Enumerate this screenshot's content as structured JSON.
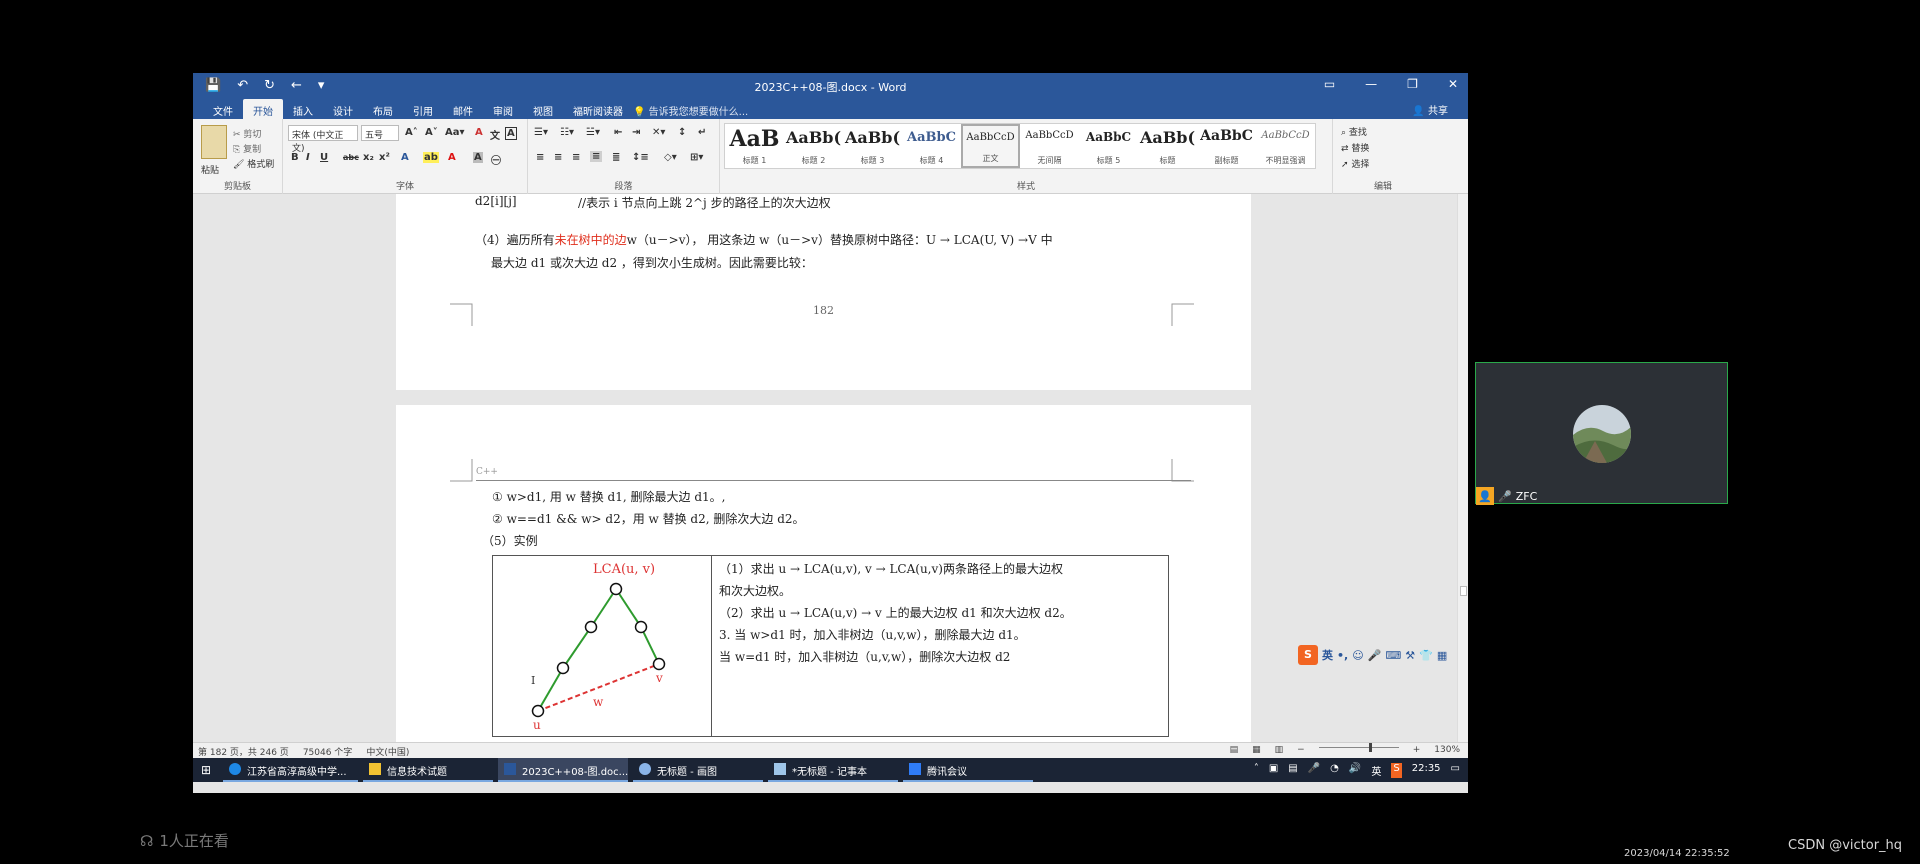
{
  "word": {
    "title": "2023C++08-图.docx - Word",
    "menu_tabs": [
      "文件",
      "开始",
      "插入",
      "设计",
      "布局",
      "引用",
      "邮件",
      "审阅",
      "视图",
      "福昕阅读器"
    ],
    "active_tab_index": 1,
    "tell_me": "告诉我您想要做什么...",
    "share": "共享",
    "ribbon": {
      "clipboard": {
        "paste": "粘贴",
        "cut": "剪切",
        "copy": "复制",
        "format_painter": "格式刷",
        "label": "剪贴板"
      },
      "font": {
        "font_name": "宋体 (中文正文)",
        "font_size": "五号",
        "label": "字体"
      },
      "paragraph": {
        "label": "段落"
      },
      "styles": {
        "label": "样式",
        "items": [
          {
            "sample": "AaB",
            "name": "标题 1"
          },
          {
            "sample": "AaBb(",
            "name": "标题 2"
          },
          {
            "sample": "AaBb(",
            "name": "标题 3"
          },
          {
            "sample": "AaBbC",
            "name": "标题 4"
          },
          {
            "sample": "AaBbCcD",
            "name": "正文"
          },
          {
            "sample": "AaBbCcD",
            "name": "无间隔"
          },
          {
            "sample": "AaBbC",
            "name": "标题 5"
          },
          {
            "sample": "AaBb(",
            "name": "标题"
          },
          {
            "sample": "AaBbC",
            "name": "副标题"
          },
          {
            "sample": "AaBbCcD",
            "name": "不明显强调"
          }
        ]
      },
      "editing": {
        "find": "查找",
        "replace": "替换",
        "select": "选择",
        "label": "编辑"
      }
    },
    "document": {
      "p1_line0_code": "d2[i][j]",
      "p1_line0_comment": "//表示 i 节点向上跳 2^j 步的路径上的次大边权",
      "p1_line1_a": "（4）遍历所有",
      "p1_line1_red": "未在树中的边",
      "p1_line1_b": "w（u－>v），  用这条边 w（u－>v）替换原树中路径：U → LCA(U, V) →V 中",
      "p1_line2": "最大边 d1 或次大边 d2 ，得到次小生成树。因此需要比较：",
      "page_number": "182",
      "header_text": "C++",
      "p2_line1": "① w>d1,   用 w 替换 d1,   删除最大边 d1。,",
      "p2_line2": "② w==d1 && w> d2，用 w 替换 d2,   删除次大边 d2。",
      "p2_line3": "（5）实例",
      "diagram": {
        "title": "LCA(u, v)",
        "label_u": "u",
        "label_v": "v",
        "label_w": "w",
        "label_l": "I"
      },
      "box_lines": [
        "（1）求出 u → LCA(u,v),  v → LCA(u,v)两条路径上的最大边权",
        "和次大边权。",
        "（2）求出 u → LCA(u,v) → v 上的最大边权 d1 和次大边权 d2。",
        "3.  当 w>d1 时，加入非树边（u,v,w），删除最大边 d1。",
        "    当 w=d1 时，加入非树边（u,v,w），删除次大边权 d2"
      ]
    },
    "status": {
      "page": "第 182 页，共 246 页",
      "words": "75046 个字",
      "language": "中文(中国)",
      "zoom": "130%"
    }
  },
  "taskbar": {
    "items": [
      "江苏省高淳高级中学...",
      "信息技术试题",
      "2023C++08-图.doc...",
      "无标题 - 画图",
      "*无标题 - 记事本",
      "腾讯会议"
    ],
    "ime": "英",
    "clock": "22:35"
  },
  "ime_bar": {
    "label": "英"
  },
  "meeting": {
    "participant_name": "ZFC",
    "viewers": "1人正在看"
  },
  "overlay": {
    "timestamp": "2023/04/14 22:35:52",
    "watermark": "CSDN @victor_hq"
  },
  "colors": {
    "word_blue": "#2b579a",
    "red_text": "#e0301e",
    "green_text": "#2e9b2e",
    "tile_border": "#2aa84a"
  }
}
